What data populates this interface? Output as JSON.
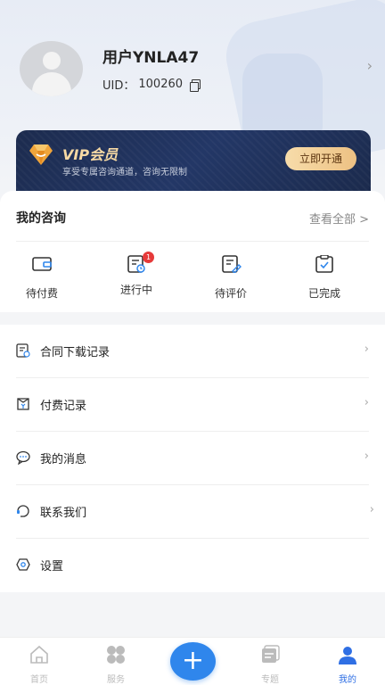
{
  "profile": {
    "username": "用户YNLA47",
    "uid_label": "UID：",
    "uid_value": "100260"
  },
  "vip": {
    "title": "VIP会员",
    "subtitle": "享受专属咨询通道，咨询无限制",
    "button_label": "立即开通"
  },
  "consult": {
    "title": "我的咨询",
    "view_all": "查看全部 >",
    "statuses": [
      {
        "label": "待付费",
        "icon": "wallet-icon"
      },
      {
        "label": "进行中",
        "icon": "in-progress-icon",
        "badge": "1"
      },
      {
        "label": "待评价",
        "icon": "review-icon"
      },
      {
        "label": "已完成",
        "icon": "completed-icon"
      }
    ]
  },
  "menu": [
    {
      "label": "合同下载记录",
      "icon": "contract-icon"
    },
    {
      "label": "付费记录",
      "icon": "payment-record-icon"
    },
    {
      "label": "我的消息",
      "icon": "message-icon"
    },
    {
      "label": "联系我们",
      "icon": "contact-icon"
    },
    {
      "label": "设置",
      "icon": "settings-icon"
    }
  ],
  "tabbar": {
    "home": "首页",
    "service": "服务",
    "topic": "专题",
    "mine": "我的",
    "fab": "+"
  },
  "colors": {
    "accent": "#2f86ec",
    "vip_gold": "#f6d9a4",
    "badge_red": "#e63a3a"
  }
}
